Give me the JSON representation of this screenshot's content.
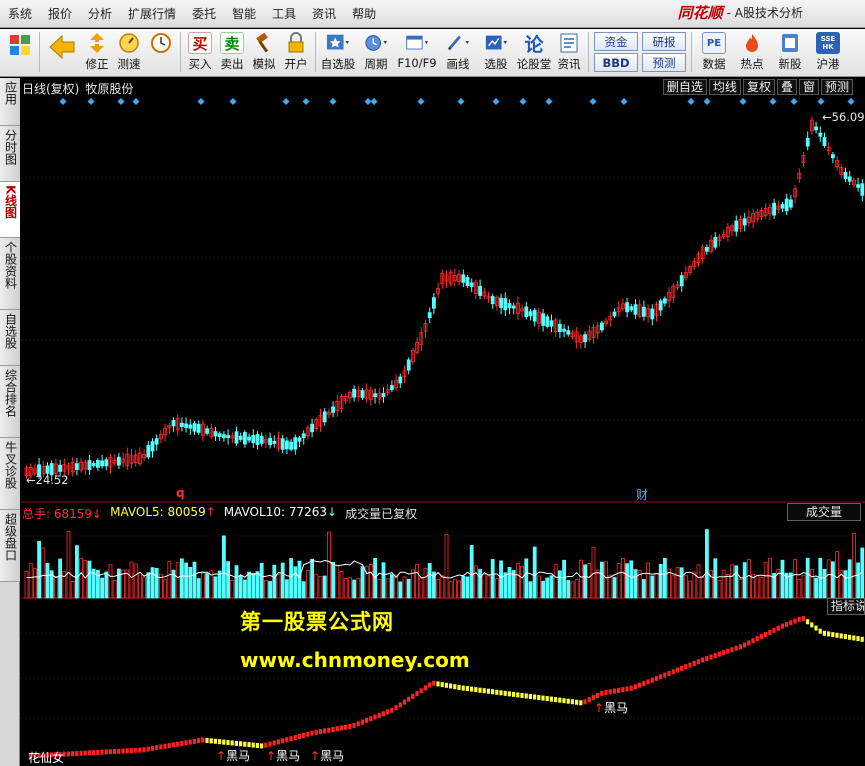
{
  "menubar": {
    "items": [
      "系统",
      "报价",
      "分析",
      "扩展行情",
      "委托",
      "智能",
      "工具",
      "资讯",
      "帮助"
    ],
    "brand": "同花顺",
    "subtitle": "- A股技术分析"
  },
  "toolbar": {
    "buttons": [
      {
        "label": "",
        "icon": "back-arrow-icon"
      },
      {
        "label": "修正",
        "icon": "fix-icon"
      },
      {
        "label": "测速",
        "icon": "speed-icon"
      },
      {
        "label": "买入",
        "icon": "buy-icon",
        "glyph": "买"
      },
      {
        "label": "卖出",
        "icon": "sell-icon",
        "glyph": "卖"
      },
      {
        "label": "模拟",
        "icon": "simulate-icon"
      },
      {
        "label": "开户",
        "icon": "lock-icon"
      },
      {
        "label": "自选股",
        "icon": "favorites-icon"
      },
      {
        "label": "周期",
        "icon": "period-icon"
      },
      {
        "label": "F10/F9",
        "icon": "f10-icon"
      },
      {
        "label": "画线",
        "icon": "draw-line-icon"
      },
      {
        "label": "选股",
        "icon": "stock-picker-icon"
      },
      {
        "label": "论股堂",
        "icon": "forum-icon",
        "glyph": "论"
      },
      {
        "label": "资讯",
        "icon": "news-icon"
      }
    ],
    "box_buttons": [
      "资金",
      "BBD",
      "研报",
      "预测"
    ],
    "right_buttons": [
      {
        "label": "数据",
        "icon": "pe-icon",
        "glyph": "PE"
      },
      {
        "label": "热点",
        "icon": "hot-icon"
      },
      {
        "label": "新股",
        "icon": "ipo-icon"
      },
      {
        "label": "沪港",
        "icon": "hk-connect-icon",
        "glyph": "SSE HK"
      }
    ]
  },
  "left_tabs": [
    "应用",
    "分时图",
    "K线图",
    "个股资料",
    "自选股",
    "综合排名",
    "牛叉诊股",
    "超级盘口"
  ],
  "active_tab": "K线图",
  "chart_header": {
    "period": "日线(复权)",
    "stock": "牧原股份",
    "tools": [
      "删自选",
      "均线",
      "复权",
      "叠",
      "窗",
      "预测"
    ]
  },
  "price": {
    "high_label": "56.09",
    "low_label": "24.52",
    "marker_q": "q",
    "marker_cai": "财"
  },
  "volume_panel": {
    "total_label": "总手: 68159",
    "total_color": "#ff3030",
    "mavol5_label": "MAVOL5: 80059",
    "mavol5_color": "#ffff40",
    "mavol10_label": "MAVOL10: 77263",
    "mavol10_color": "#ffffff",
    "note": "成交量已复权",
    "button": "成交量"
  },
  "indicator_panel": {
    "button": "指标说明",
    "label_left": "花仙女",
    "signal_label": "黑马",
    "signals": [
      "黑马",
      "黑马",
      "黑马",
      "黑马"
    ]
  },
  "watermark": {
    "line1": "第一股票公式网",
    "line2": "www.chnmoney.com"
  },
  "colors": {
    "up": "#ff2a2a",
    "down": "#55ffff",
    "background": "#000000",
    "grid": "#7a1010",
    "indicator_up": "#ff2020",
    "indicator_down": "#ffff40",
    "diamond": "#3fa9f5"
  }
}
